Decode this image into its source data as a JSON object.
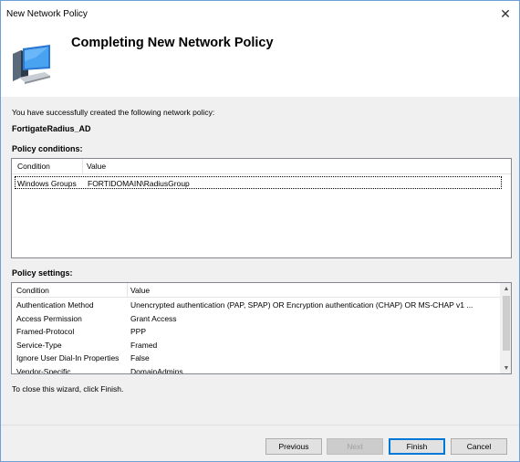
{
  "window": {
    "title": "New Network Policy",
    "close_glyph": "✕"
  },
  "header": {
    "title": "Completing New Network Policy",
    "icon": "monitor-computer-icon"
  },
  "intro_text": "You have successfully created the following network policy:",
  "policy_name": "FortigateRadius_AD",
  "conditions": {
    "label": "Policy conditions:",
    "columns": [
      "Condition",
      "Value"
    ],
    "rows": [
      {
        "condition": "Windows Groups",
        "value": "FORTIDOMAIN\\RadiusGroup"
      }
    ]
  },
  "settings": {
    "label": "Policy settings:",
    "columns": [
      "Condition",
      "Value"
    ],
    "rows": [
      {
        "condition": "Authentication Method",
        "value": "Unencrypted authentication (PAP, SPAP) OR Encryption authentication (CHAP) OR MS-CHAP v1 ..."
      },
      {
        "condition": "Access Permission",
        "value": "Grant Access"
      },
      {
        "condition": "Framed-Protocol",
        "value": "PPP"
      },
      {
        "condition": "Service-Type",
        "value": "Framed"
      },
      {
        "condition": "Ignore User Dial-In Properties",
        "value": "False"
      },
      {
        "condition": "Vendor-Specific",
        "value": "DomainAdmins"
      }
    ]
  },
  "close_hint": "To close this wizard, click Finish.",
  "buttons": {
    "previous": "Previous",
    "next": "Next",
    "finish": "Finish",
    "cancel": "Cancel"
  },
  "colors": {
    "window_border": "#6e9fd6",
    "default_button_border": "#0078d7"
  }
}
